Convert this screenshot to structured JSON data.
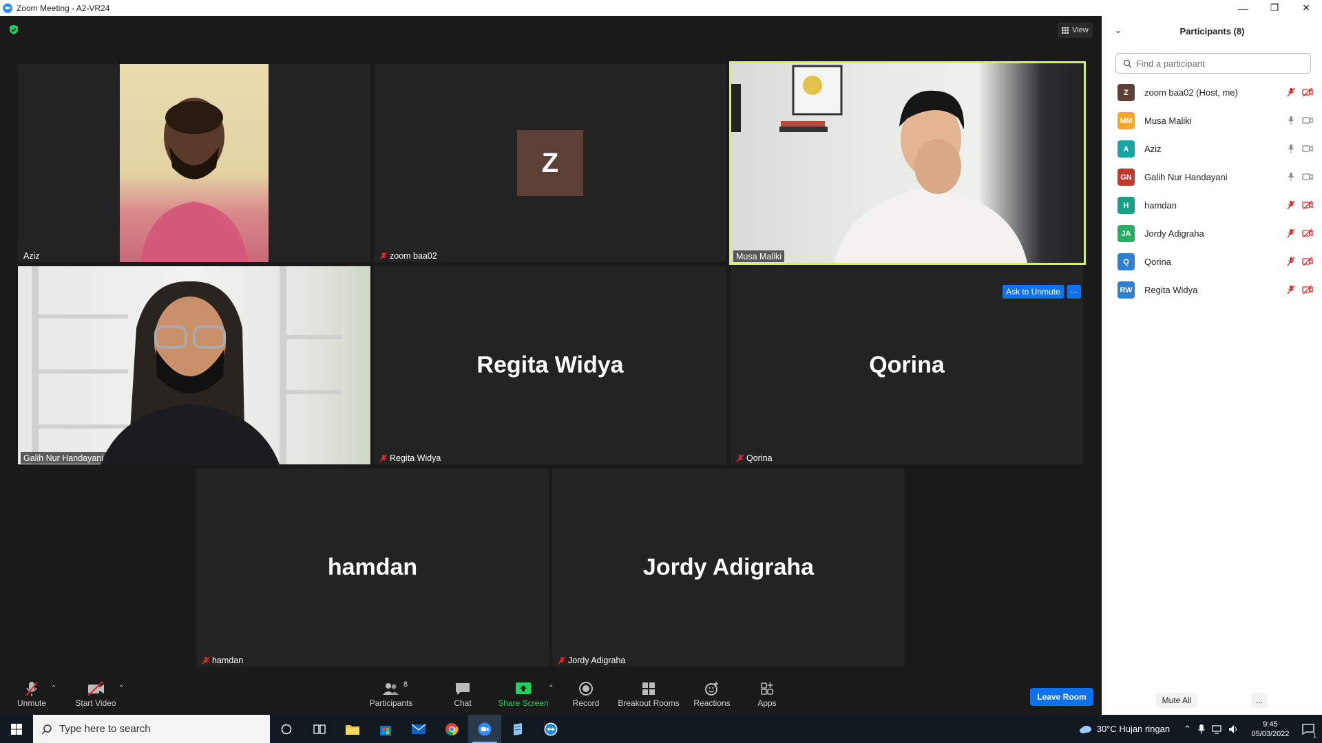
{
  "window": {
    "title": "Zoom Meeting - A2-VR24"
  },
  "top_bar": {
    "view_label": "View"
  },
  "tiles": {
    "aziz": {
      "name": "Aziz"
    },
    "zoom": {
      "name": "zoom baa02",
      "avatar_letter": "Z"
    },
    "musa": {
      "name": "Musa Maliki"
    },
    "galih": {
      "name": "Galih Nur Handayani"
    },
    "regita": {
      "name": "Regita Widya",
      "big": "Regita Widya"
    },
    "qorina": {
      "name": "Qorina",
      "big": "Qorina"
    },
    "hamdan": {
      "name": "hamdan",
      "big": "hamdan"
    },
    "jordy": {
      "name": "Jordy Adigraha",
      "big": "Jordy Adigraha"
    }
  },
  "tile_actions": {
    "ask_to_unmute": "Ask to Unmute",
    "more": "···"
  },
  "toolbar": {
    "unmute": "Unmute",
    "start_video": "Start Video",
    "participants": "Participants",
    "participants_count": "8",
    "chat": "Chat",
    "share_screen": "Share Screen",
    "record": "Record",
    "breakout_rooms": "Breakout Rooms",
    "reactions": "Reactions",
    "apps": "Apps",
    "leave_room": "Leave Room"
  },
  "panel": {
    "title": "Participants (8)",
    "search_placeholder": "Find a participant",
    "participants": [
      {
        "initials": "Z",
        "name": "zoom baa02 (Host, me)",
        "color": "#5c4036",
        "muted": true
      },
      {
        "initials": "MM",
        "name": "Musa Maliki",
        "color": "#f5a623",
        "muted": false
      },
      {
        "initials": "A",
        "name": "Aziz",
        "color": "#1aa3a3",
        "muted": false
      },
      {
        "initials": "GN",
        "name": "Galih Nur Handayani",
        "color": "#c0392b",
        "muted": false
      },
      {
        "initials": "H",
        "name": "hamdan",
        "color": "#16a085",
        "muted": true
      },
      {
        "initials": "JA",
        "name": "Jordy Adigraha",
        "color": "#27ae60",
        "muted": true
      },
      {
        "initials": "Q",
        "name": "Qorina",
        "color": "#2d7fd0",
        "muted": true
      },
      {
        "initials": "RW",
        "name": "Regita Widya",
        "color": "#2d7fd0",
        "muted": true
      }
    ],
    "mute_all": "Mute All",
    "more": "..."
  },
  "taskbar": {
    "search_placeholder": "Type here to search",
    "weather": "30°C  Hujan ringan",
    "time": "9:45",
    "date": "05/03/2022",
    "notification_count": "1"
  }
}
